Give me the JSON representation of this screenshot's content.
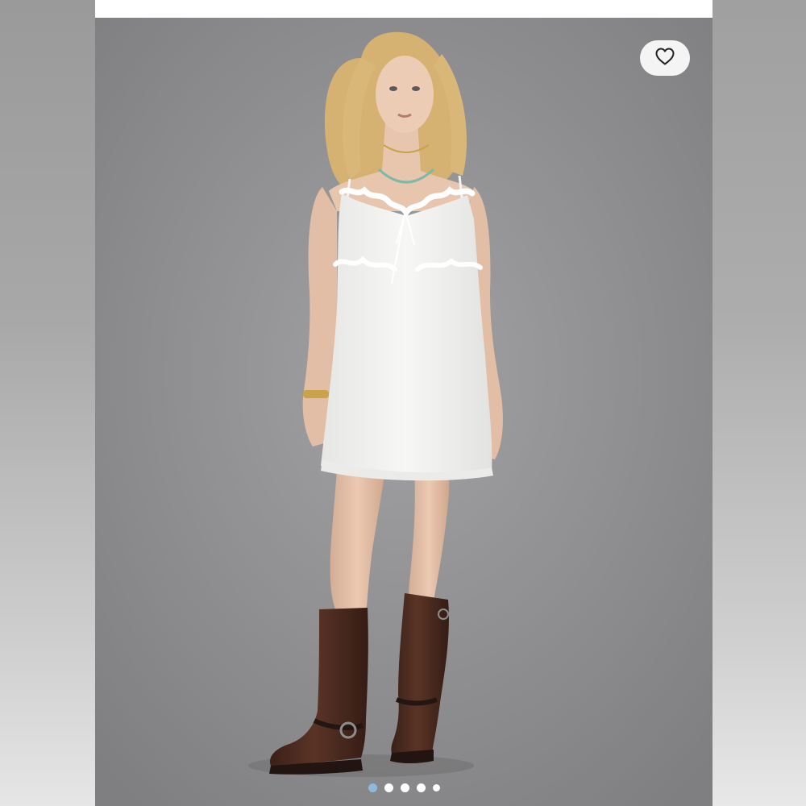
{
  "product_image": {
    "description_alt": "",
    "model": {
      "dress_color": "#f4f4f2",
      "boots_color": "#4a2a1f",
      "hair_color": "#d9b779",
      "skin_color": "#e9c9b2"
    },
    "background_color": "#8f8f91"
  },
  "wishlist": {
    "icon": "heart-outline-icon",
    "button_color": "#f4f4f4"
  },
  "carousel": {
    "total": 5,
    "active_index": 0,
    "active_color": "#8fb9d8",
    "inactive_color": "#ffffff"
  }
}
